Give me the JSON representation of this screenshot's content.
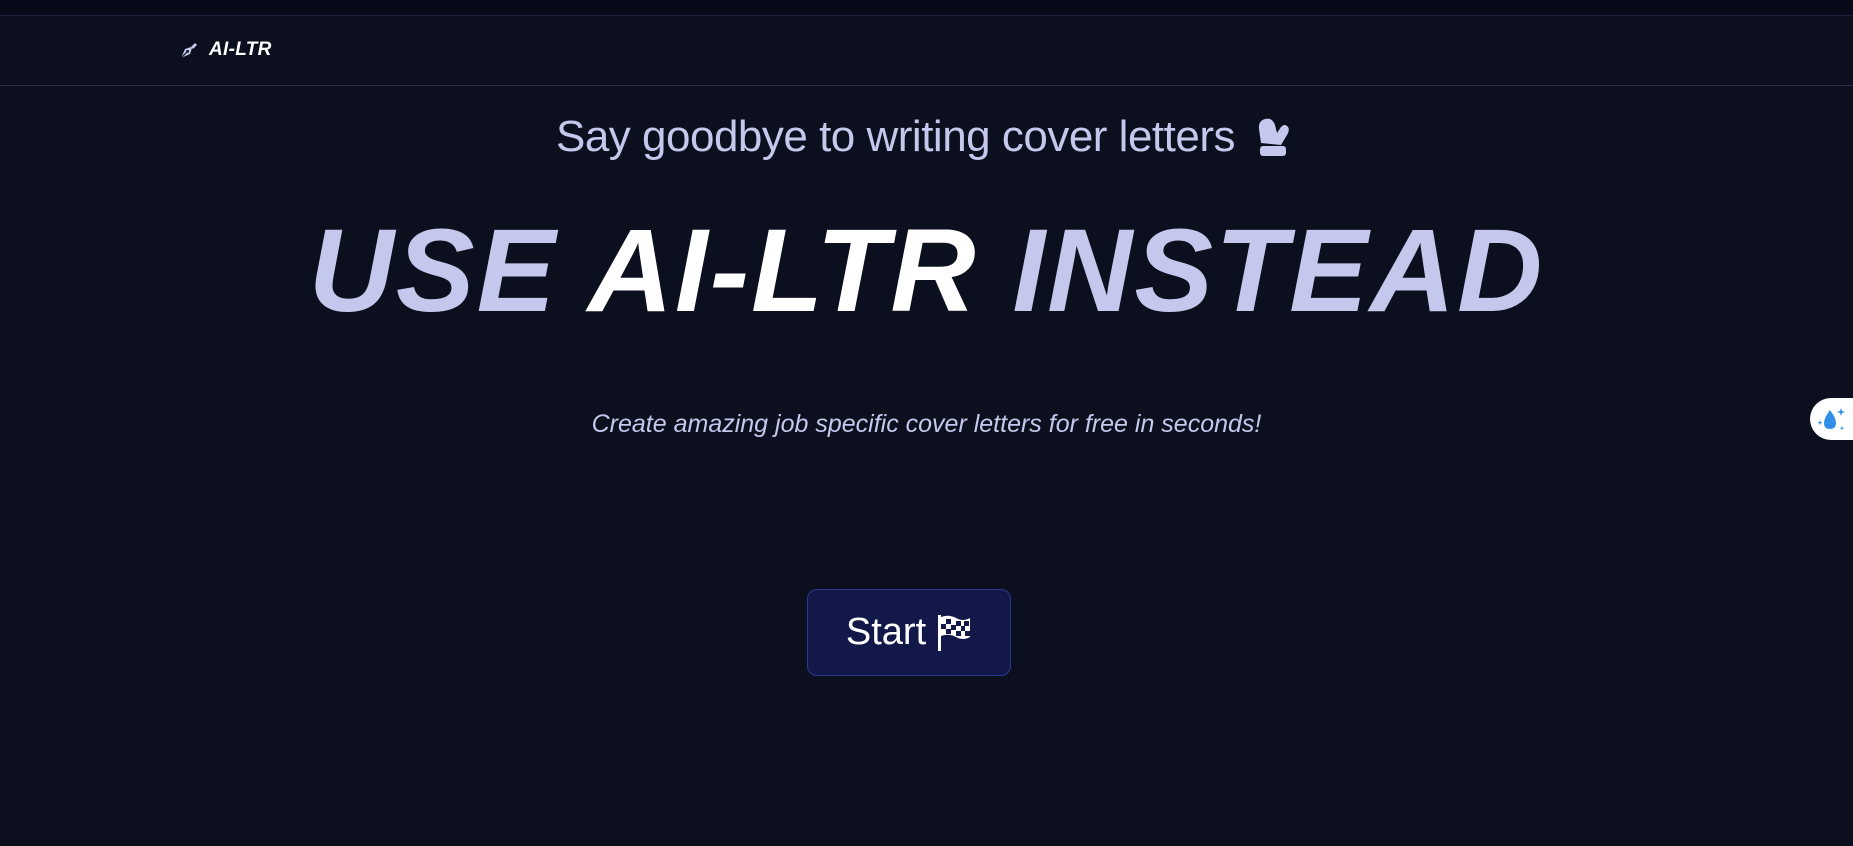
{
  "navbar": {
    "brand_icon": "fountain-pen-icon",
    "brand_name": "AI-LTR"
  },
  "hero": {
    "tagline": "Say goodbye to writing cover letters",
    "tagline_icon": "mitten-icon",
    "headline_part1": "USE ",
    "headline_part2": "AI-LTR",
    "headline_part3": " INSTEAD",
    "subtext": "Create amazing job specific cover letters for free in seconds!",
    "start_label": "Start",
    "start_icon": "checkered-flag-icon"
  },
  "side_widget": {
    "icon": "droplet-sparkle-icon"
  },
  "colors": {
    "background": "#0c0f1d",
    "accent_text": "#c3c8ec",
    "headline_highlight": "#ffffff",
    "button_bg": "#121848",
    "button_border": "#2d3890"
  }
}
